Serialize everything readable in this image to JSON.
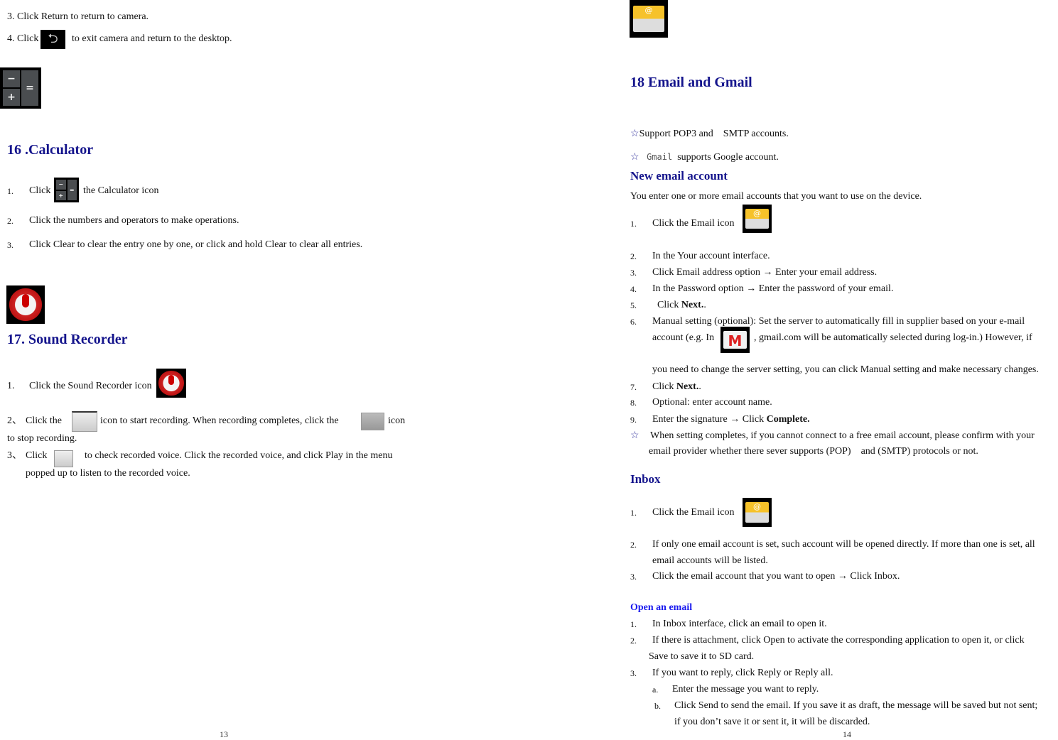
{
  "left": {
    "l1": "3. Click Return to return to camera.",
    "l2a": "4. Click",
    "l2b": "to exit camera and return to the desktop.",
    "calc_heading": "16 .Calculator",
    "calc_steps": [
      {
        "num": "1.",
        "a": "Click",
        "b": "the Calculator icon"
      },
      {
        "num": "2.",
        "a": "Click the numbers and operators to make operations."
      },
      {
        "num": "3.",
        "a": "Click Clear to clear the entry one by one, or click and hold Clear to clear all entries."
      }
    ],
    "rec_heading": "17. Sound Recorder",
    "rec_steps": {
      "s1_num": "1.",
      "s1": "Click the Sound Recorder icon",
      "s2_num": "2、",
      "s2a": "Click the",
      "s2b": "icon to start recording. When recording completes, click the",
      "s2c": "icon",
      "s2d": "to stop recording.",
      "s3_num": "3、",
      "s3a": "Click",
      "s3b": "to check recorded voice. Click the recorded voice, and click Play in the menu",
      "s3c": "popped up to listen to the recorded voice."
    },
    "page_number": "13"
  },
  "right": {
    "heading": "18 Email and Gmail",
    "star": "☆",
    "b1": "Support POP3 and    SMTP accounts.",
    "b2_code": "Gmail",
    "b2": "supports Google account.",
    "new_heading": "New email account",
    "intro": "You enter one or more email accounts that you want to use on the device.",
    "n1_num": "1.",
    "n1": "Click the Email icon",
    "n2_num": "2.",
    "n2": "In the Your account interface.",
    "n3_num": "3.",
    "n3": "Click Email address option → Enter your email address.",
    "n4_num": "4.",
    "n4": "In the Password option → Enter the password of your email.",
    "n5_num": "5.",
    "n5a": "Click ",
    "n5b": "Next.",
    "n5c": ".",
    "n6_num": "6.",
    "n6a": "Manual setting (optional): Set the server to automatically fill in supplier based on your e-mail",
    "n6b": "account (e.g. In",
    "n6c": ", gmail.com will be automatically selected during log-in.) However, if",
    "n6d": "you need to change the server setting, you can click Manual setting and make necessary changes.",
    "n7_num": "7.",
    "n7a": "Click ",
    "n7b": "Next.",
    "n7c": ".",
    "n8_num": "8.",
    "n8": "Optional: enter account name.",
    "n9_num": "9.",
    "n9a": "Enter the signature → Click ",
    "n9b": "Complete.",
    "note1": "When setting completes, if you cannot connect to a free email account, please confirm with your",
    "note2": "email provider whether there sever supports (POP)    and (SMTP) protocols or not.",
    "inbox_heading": "Inbox",
    "i1_num": "1.",
    "i1": "Click the Email icon",
    "i2_num": "2.",
    "i2a": "If only one email account is set, such account will be opened directly. If more than one is set, all",
    "i2b": "email accounts will be listed.",
    "i3_num": "3.",
    "i3": "Click the email account that you want to open → Click Inbox.",
    "open_heading": "Open an email",
    "o1_num": "1.",
    "o1": "In Inbox interface, click an email to open it.",
    "o2_num": "2.",
    "o2a": "If there is attachment, click Open to activate the corresponding application to open it, or click",
    "o2b": "Save to save it to SD card.",
    "o3_num": "3.",
    "o3": "If you want to reply, click Reply or Reply all.",
    "oa_num": "a.",
    "oa": "Enter the message you want to reply.",
    "ob_num": "b.",
    "ob1": "Click Send to send the email. If you save it as draft, the message will be saved but not sent;",
    "ob2": "if you don’t save it or sent it, it will be discarded.",
    "page_number": "14"
  },
  "icons": {
    "calc_ops": [
      "−",
      "+",
      "="
    ],
    "mail_at": "@",
    "gmail_m": "M"
  },
  "colors": {
    "heading": "#14148c",
    "subheading": "#1a1aee"
  }
}
